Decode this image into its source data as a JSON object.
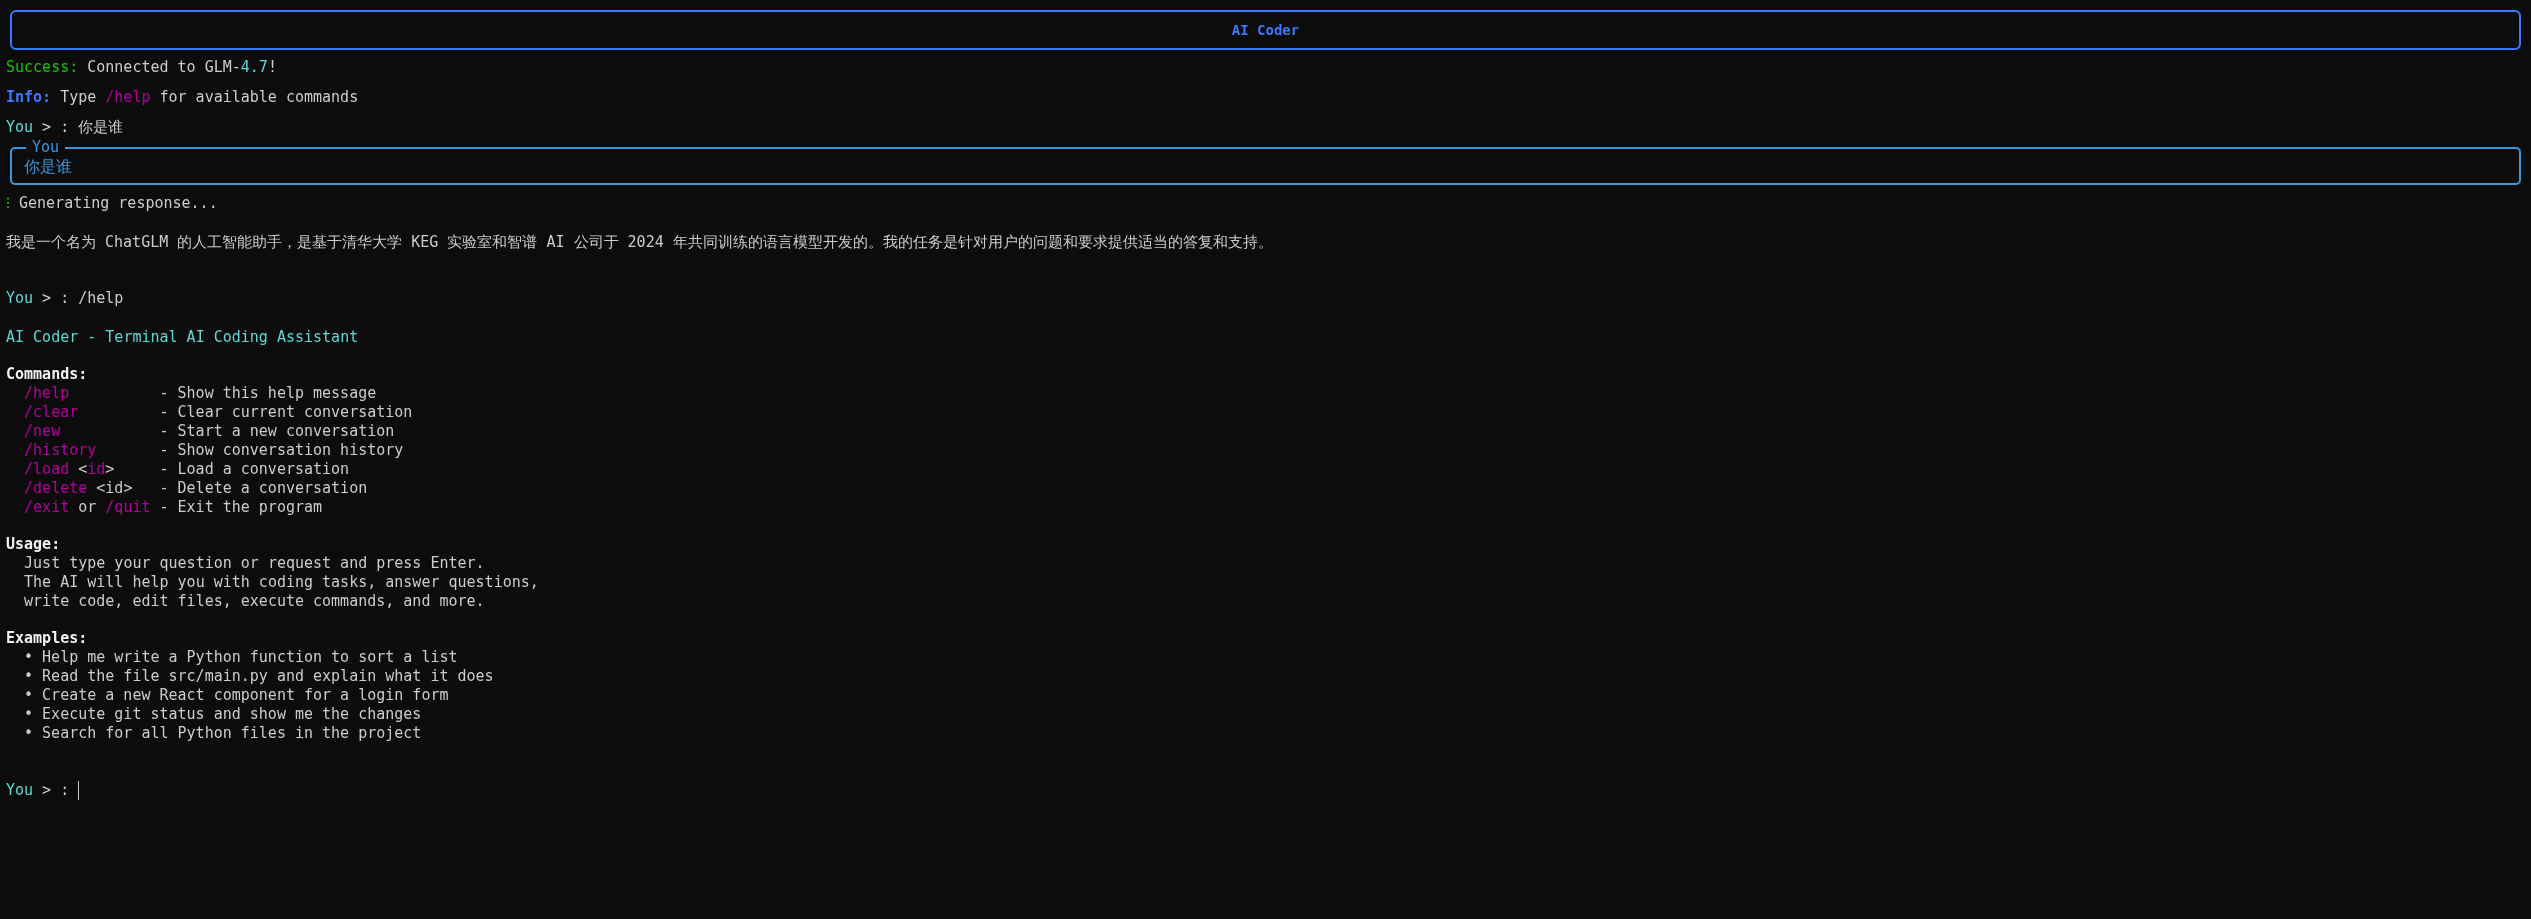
{
  "title": "AI Coder",
  "transcript": [
    {
      "kind": "success_notice",
      "label": "Success:",
      "parts": [
        {
          "text": "Connected to GLM-"
        },
        {
          "text": "4.7",
          "kind": "number"
        },
        {
          "text": "!"
        }
      ]
    },
    {
      "kind": "info_notice",
      "label": "Info:",
      "parts": [
        {
          "text": "Type "
        },
        {
          "text": "/help",
          "kind": "command"
        },
        {
          "text": " for available commands"
        }
      ]
    },
    {
      "kind": "prompt",
      "label": "You",
      "separator": ">",
      "colon": ":",
      "input": "你是谁"
    },
    {
      "kind": "message_box",
      "label": "You",
      "text": "你是谁"
    },
    {
      "kind": "progress",
      "spinner": "⁝",
      "text": "Generating response..."
    },
    {
      "kind": "reply",
      "text": "我是一个名为 ChatGLM 的人工智能助手，是基于清华大学 KEG 实验室和智谱 AI 公司于 2024 年共同训练的语言模型开发的。我的任务是针对用户的问题和要求提供适当的答复和支持。"
    },
    {
      "kind": "prompt",
      "label": "You",
      "separator": ">",
      "colon": ":",
      "input": "/help"
    },
    {
      "kind": "help",
      "heading": "AI Coder - Terminal AI Coding Assistant",
      "sections": [
        {
          "title": "Commands:",
          "kind": "commands",
          "rows": [
            {
              "command": [
                {
                  "text": "/help",
                  "kind": "command"
                }
              ],
              "description": "- Show this help message"
            },
            {
              "command": [
                {
                  "text": "/clear",
                  "kind": "command"
                }
              ],
              "description": "- Clear current conversation"
            },
            {
              "command": [
                {
                  "text": "/new",
                  "kind": "command"
                }
              ],
              "description": "- Start a new conversation"
            },
            {
              "command": [
                {
                  "text": "/history",
                  "kind": "command"
                }
              ],
              "description": "- Show conversation history"
            },
            {
              "command": [
                {
                  "text": "/load",
                  "kind": "command"
                },
                {
                  "text": " <"
                },
                {
                  "text": "id",
                  "kind": "command"
                },
                {
                  "text": ">"
                }
              ],
              "description": "- Load a conversation"
            },
            {
              "command": [
                {
                  "text": "/delete",
                  "kind": "command"
                },
                {
                  "text": " <id>"
                }
              ],
              "description": "- Delete a conversation"
            },
            {
              "command": [
                {
                  "text": "/exit",
                  "kind": "command"
                },
                {
                  "text": " or "
                },
                {
                  "text": "/quit",
                  "kind": "command"
                }
              ],
              "description": "- Exit the program"
            }
          ]
        },
        {
          "title": "Usage:",
          "kind": "text",
          "lines": [
            "Just type your question or request and press Enter.",
            "The AI will help you with coding tasks, answer questions,",
            "write code, edit files, execute commands, and more."
          ]
        },
        {
          "title": "Examples:",
          "kind": "bullets",
          "bullet": "•",
          "lines": [
            "Help me write a Python function to sort a list",
            "Read the file src/main.py and explain what it does",
            "Create a new React component for a login form",
            "Execute git status and show me the changes",
            "Search for all Python files in the project"
          ]
        }
      ]
    },
    {
      "kind": "prompt",
      "label": "You",
      "separator": ">",
      "colon": ":",
      "cursor": true
    }
  ]
}
